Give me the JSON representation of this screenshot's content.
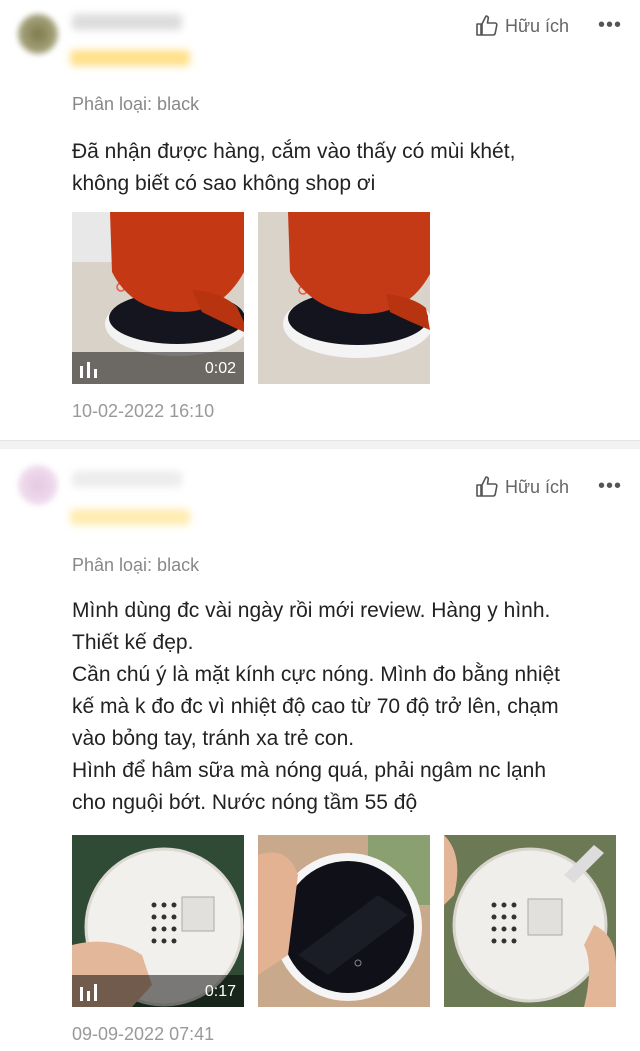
{
  "reviews": [
    {
      "helpful_label": "Hữu ích",
      "more_label": "•••",
      "variation": "Phân loại: black",
      "content": "Đã nhận được hàng, cắm vào thấy có mùi khét,\nkhông biết có sao không shop ơi",
      "video_duration": "0:02",
      "timestamp": "10-02-2022 16:10"
    },
    {
      "helpful_label": "Hữu ích",
      "more_label": "•••",
      "variation": "Phân loại: black",
      "content": "Mình dùng đc vài ngày rồi mới review. Hàng y hình.\nThiết kế đẹp.\nCần chú ý là mặt kính cực nóng. Mình đo bằng nhiệt\nkế mà k đo đc vì nhiệt độ cao từ 70 độ trở lên, chạm\nvào bỏng tay, tránh xa trẻ con.\nHình để hâm sữa mà nóng quá, phải ngâm nc lạnh\ncho nguội bớt. Nước nóng tầm 55 độ",
      "video_duration": "0:17",
      "timestamp": "09-09-2022 07:41"
    }
  ],
  "icons": {
    "helpful": "thumbs-up-icon",
    "video": "video-bars-icon"
  }
}
